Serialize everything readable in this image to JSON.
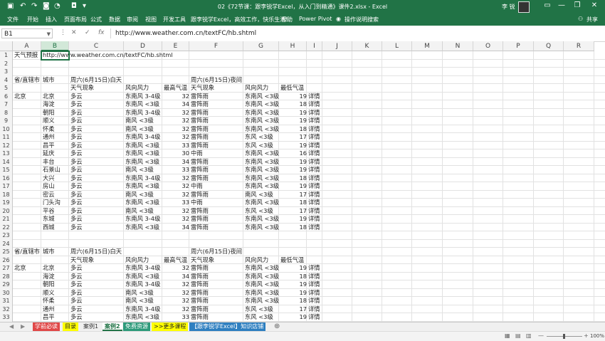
{
  "titlebar": {
    "title": "02《72节课：跟李锐学Excel，从入门到精通》课件2.xlsx - Excel",
    "user": "李 锐",
    "minimize": "—",
    "restore": "❐",
    "close": "✕",
    "ribbon_display": "▭"
  },
  "ribbon_tabs": [
    "文件",
    "开始",
    "插入",
    "页面布局",
    "公式",
    "数据",
    "审阅",
    "视图",
    "开发工具",
    "跟李锐学Excel，高效工作，快乐生活!",
    "帮助",
    "Power Pivot",
    "操作说明搜索"
  ],
  "ribbon_share": "共享",
  "formula_bar": {
    "name_box": "B1",
    "cancel": "✕",
    "enter": "✓",
    "fx": "fx",
    "content": "http://www.weather.com.cn/textFC/hb.shtml"
  },
  "columns": [
    "A",
    "B",
    "C",
    "D",
    "E",
    "F",
    "G",
    "H",
    "I",
    "J",
    "K",
    "L",
    "M",
    "N",
    "O",
    "P",
    "Q",
    "R"
  ],
  "selected_column": "B",
  "row_numbers": [
    "1",
    "2",
    "3",
    "4",
    "5",
    "6",
    "7",
    "8",
    "9",
    "10",
    "11",
    "12",
    "13",
    "14",
    "15",
    "16",
    "17",
    "18",
    "19",
    "20",
    "21",
    "22",
    "23",
    "24",
    "25",
    "26",
    "27",
    "28",
    "29",
    "30",
    "31",
    "32",
    "33"
  ],
  "rows": [
    [
      "天气预报",
      "http://www.weather.com.cn/textFC/hb.shtml",
      "",
      "",
      "",
      "",
      "",
      "",
      "",
      ""
    ],
    [
      "",
      "",
      "",
      "",
      "",
      "",
      "",
      "",
      "",
      ""
    ],
    [
      "",
      "",
      "",
      "",
      "",
      "",
      "",
      "",
      "",
      ""
    ],
    [
      "省/直辖市",
      "城市",
      "周六(6月15日)白天",
      "",
      "",
      "周六(6月15日)夜间",
      "",
      "",
      "",
      ""
    ],
    [
      "",
      "",
      "天气现象",
      "风向风力",
      "最高气温",
      "天气现象",
      "风向风力",
      "最低气温",
      "",
      ""
    ],
    [
      "北京",
      "北京",
      "多云",
      "东南风 3-4级",
      "32",
      "雷阵雨",
      "东南风 <3级",
      "19",
      "详情",
      ""
    ],
    [
      "",
      "海淀",
      "多云",
      "东南风 <3级",
      "34",
      "雷阵雨",
      "东南风 <3级",
      "18",
      "详情",
      ""
    ],
    [
      "",
      "朝阳",
      "多云",
      "东南风 3-4级",
      "32",
      "雷阵雨",
      "东南风 <3级",
      "19",
      "详情",
      ""
    ],
    [
      "",
      "顺义",
      "多云",
      "南风 <3级",
      "32",
      "雷阵雨",
      "东南风 <3级",
      "19",
      "详情",
      ""
    ],
    [
      "",
      "怀柔",
      "多云",
      "南风 <3级",
      "32",
      "雷阵雨",
      "东南风 <3级",
      "18",
      "详情",
      ""
    ],
    [
      "",
      "通州",
      "多云",
      "东南风 3-4级",
      "32",
      "雷阵雨",
      "东风 <3级",
      "17",
      "详情",
      ""
    ],
    [
      "",
      "昌平",
      "多云",
      "东南风 <3级",
      "33",
      "雷阵雨",
      "东风 <3级",
      "19",
      "详情",
      ""
    ],
    [
      "",
      "延庆",
      "多云",
      "东南风 <3级",
      "30",
      "中雨",
      "东南风 <3级",
      "16",
      "详情",
      ""
    ],
    [
      "",
      "丰台",
      "多云",
      "东南风 <3级",
      "34",
      "雷阵雨",
      "东南风 <3级",
      "19",
      "详情",
      ""
    ],
    [
      "",
      "石景山",
      "多云",
      "南风 <3级",
      "33",
      "雷阵雨",
      "东南风 <3级",
      "19",
      "详情",
      ""
    ],
    [
      "",
      "大兴",
      "多云",
      "东南风 3-4级",
      "32",
      "雷阵雨",
      "东南风 <3级",
      "18",
      "详情",
      ""
    ],
    [
      "",
      "房山",
      "多云",
      "东南风 <3级",
      "32",
      "中雨",
      "东南风 <3级",
      "19",
      "详情",
      ""
    ],
    [
      "",
      "密云",
      "多云",
      "南风 <3级",
      "32",
      "雷阵雨",
      "南风 <3级",
      "17",
      "详情",
      ""
    ],
    [
      "",
      "门头沟",
      "多云",
      "东南风 <3级",
      "33",
      "中雨",
      "东南风 <3级",
      "18",
      "详情",
      ""
    ],
    [
      "",
      "平谷",
      "多云",
      "南风 <3级",
      "32",
      "雷阵雨",
      "东风 <3级",
      "17",
      "详情",
      ""
    ],
    [
      "",
      "东城",
      "多云",
      "东南风 3-4级",
      "32",
      "雷阵雨",
      "东南风 <3级",
      "19",
      "详情",
      ""
    ],
    [
      "",
      "西城",
      "多云",
      "东南风 <3级",
      "34",
      "雷阵雨",
      "东南风 <3级",
      "18",
      "详情",
      ""
    ],
    [
      "",
      "",
      "",
      "",
      "",
      "",
      "",
      "",
      "",
      ""
    ],
    [
      "",
      "",
      "",
      "",
      "",
      "",
      "",
      "",
      "",
      ""
    ],
    [
      "省/直辖市",
      "城市",
      "周六(6月15日)白天",
      "",
      "",
      "周六(6月15日)夜间",
      "",
      "",
      "",
      ""
    ],
    [
      "",
      "",
      "天气现象",
      "风向风力",
      "最高气温",
      "天气现象",
      "风向风力",
      "最低气温",
      "",
      ""
    ],
    [
      "北京",
      "北京",
      "多云",
      "东南风 3-4级",
      "32",
      "雷阵雨",
      "东南风 <3级",
      "19",
      "详情",
      ""
    ],
    [
      "",
      "海淀",
      "多云",
      "东南风 <3级",
      "34",
      "雷阵雨",
      "东南风 <3级",
      "18",
      "详情",
      ""
    ],
    [
      "",
      "朝阳",
      "多云",
      "东南风 3-4级",
      "32",
      "雷阵雨",
      "东南风 <3级",
      "19",
      "详情",
      ""
    ],
    [
      "",
      "顺义",
      "多云",
      "南风 <3级",
      "32",
      "雷阵雨",
      "东南风 <3级",
      "19",
      "详情",
      ""
    ],
    [
      "",
      "怀柔",
      "多云",
      "南风 <3级",
      "32",
      "雷阵雨",
      "东南风 <3级",
      "18",
      "详情",
      ""
    ],
    [
      "",
      "通州",
      "多云",
      "东南风 3-4级",
      "32",
      "雷阵雨",
      "东风 <3级",
      "17",
      "详情",
      ""
    ],
    [
      "",
      "昌平",
      "多云",
      "东南风 <3级",
      "33",
      "雷阵雨",
      "东风 <3级",
      "19",
      "详情",
      ""
    ]
  ],
  "sheet_tabs": [
    {
      "label": "学前必读",
      "bg": "#e04848",
      "fg": "#ffffff"
    },
    {
      "label": "目录",
      "bg": "#ffff00",
      "fg": "#222222"
    },
    {
      "label": "案例1",
      "bg": "#f0f0f0",
      "fg": "#333333"
    },
    {
      "label": "案例2",
      "bg": "#ffffff",
      "fg": "#217346"
    },
    {
      "label": "免费资源",
      "bg": "#2d9a7a",
      "fg": "#ffffff"
    },
    {
      "label": ">>更多课程",
      "bg": "#ffff00",
      "fg": "#222222"
    },
    {
      "label": "【跟李锐学Excel】知识店铺",
      "bg": "#2e7fc0",
      "fg": "#ffffff"
    }
  ],
  "active_sheet": "案例2",
  "sheet_nav": [
    "◀",
    "▶"
  ],
  "add_sheet": "⊕",
  "zoom": "100%",
  "zoom_minus": "—",
  "zoom_plus": "+",
  "colors": {
    "accent": "#217346",
    "selected_header": "#d2e8d8"
  }
}
